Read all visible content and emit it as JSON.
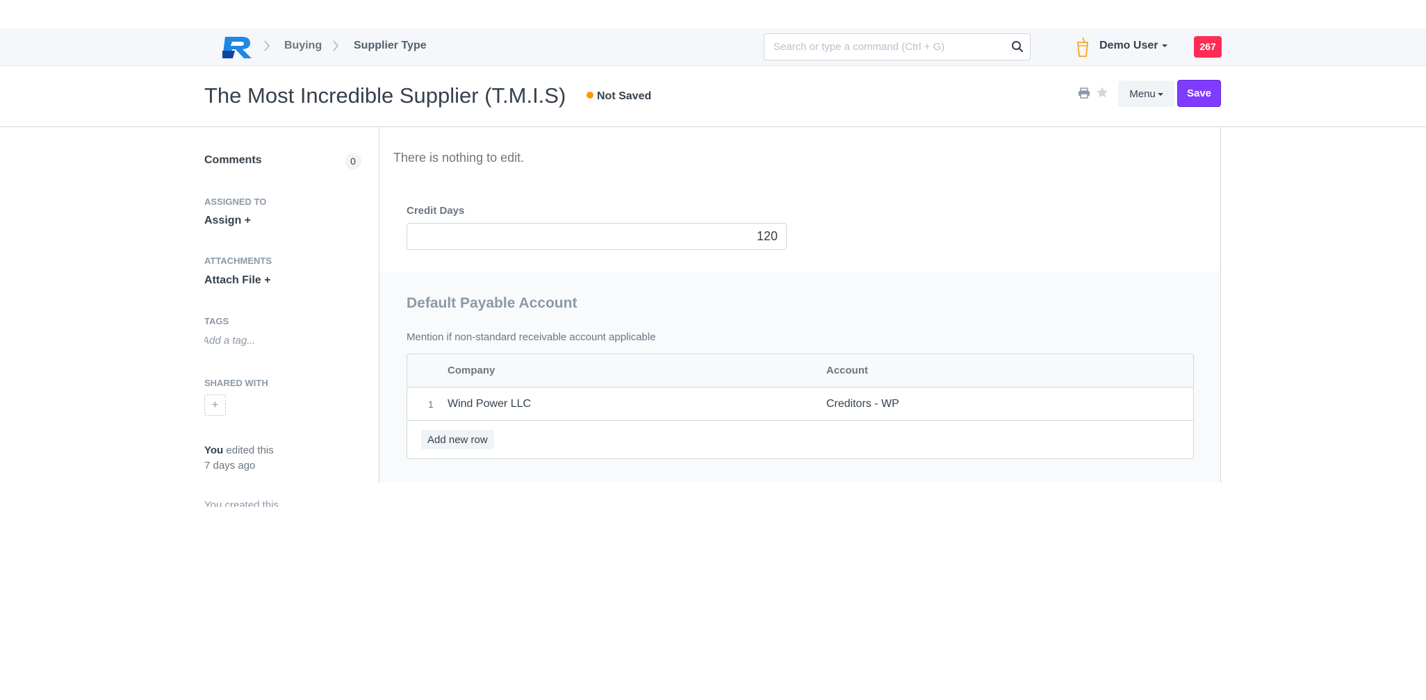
{
  "navbar": {
    "breadcrumbs": [
      "Buying",
      "Supplier Type"
    ],
    "search_placeholder": "Search or type a command (Ctrl + G)",
    "user_name": "Demo User",
    "notification_count": "267",
    "icons": [
      "app-logo-icon",
      "chevron-right-icon",
      "search-icon",
      "cup-icon",
      "caret-down-icon"
    ]
  },
  "page_head": {
    "title": "The Most Incredible Supplier (T.M.I.S)",
    "status": "Not Saved",
    "status_color": "#ff9800",
    "menu_label": "Menu",
    "save_label": "Save",
    "accent_color": "#7f3cff"
  },
  "sidebar": {
    "comments_label": "Comments",
    "comments_count": "0",
    "assigned_to_label": "ASSIGNED TO",
    "assign_link": "Assign +",
    "attachments_label": "ATTACHMENTS",
    "attach_link": "Attach File +",
    "tags_label": "TAGS",
    "tag_placeholder": "Add a tag...",
    "shared_label": "SHARED WITH",
    "share_add": "+",
    "edited_by": "You",
    "edited_text": " edited this",
    "edited_when": "7 days ago",
    "faded_text": "You created this"
  },
  "form": {
    "nothing_to_edit": "There is nothing to edit.",
    "credit_days_label": "Credit Days",
    "credit_days_value": "120",
    "section_title": "Default Payable Account",
    "section_description": "Mention if non-standard receivable account applicable",
    "table": {
      "columns": [
        "Company",
        "Account"
      ],
      "rows": [
        {
          "idx": "1",
          "company": "Wind Power LLC",
          "account": "Creditors - WP"
        }
      ],
      "add_row_label": "Add new row"
    }
  }
}
